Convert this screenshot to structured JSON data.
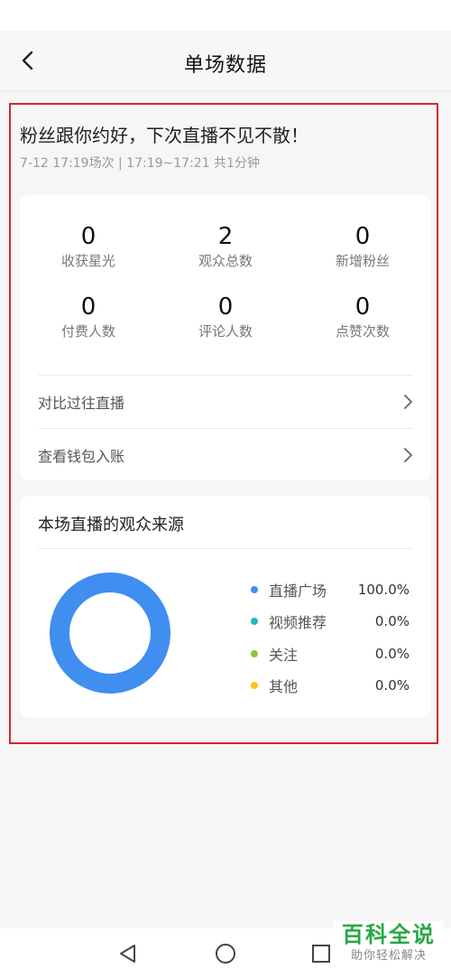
{
  "header": {
    "title": "单场数据"
  },
  "summary": {
    "headline": "粉丝跟你约好，下次直播不见不散！",
    "subline": "7-12 17:19场次 | 17:19~17:21 共1分钟"
  },
  "stats": [
    {
      "value": "0",
      "label": "收获星光"
    },
    {
      "value": "2",
      "label": "观众总数"
    },
    {
      "value": "0",
      "label": "新增粉丝"
    },
    {
      "value": "0",
      "label": "付费人数"
    },
    {
      "value": "0",
      "label": "评论人数"
    },
    {
      "value": "0",
      "label": "点赞次数"
    }
  ],
  "links": {
    "compare": "对比过往直播",
    "wallet": "查看钱包入账"
  },
  "audience": {
    "title": "本场直播的观众来源",
    "sources": [
      {
        "name": "直播广场",
        "percent": "100.0%",
        "fraction": 1.0,
        "color": "#3f8ef0"
      },
      {
        "name": "视频推荐",
        "percent": "0.0%",
        "fraction": 0.0,
        "color": "#22b8c2"
      },
      {
        "name": "关注",
        "percent": "0.0%",
        "fraction": 0.0,
        "color": "#8cc63f"
      },
      {
        "name": "其他",
        "percent": "0.0%",
        "fraction": 0.0,
        "color": "#f5c518"
      }
    ]
  },
  "watermark": {
    "main": "百科全说",
    "sub": "助你轻松解决"
  },
  "icons": {
    "back": "chevron-left-icon",
    "row_arrow": "chevron-right-icon",
    "nav_back": "triangle-back-icon",
    "nav_home": "circle-home-icon",
    "nav_recent": "square-recents-icon"
  }
}
